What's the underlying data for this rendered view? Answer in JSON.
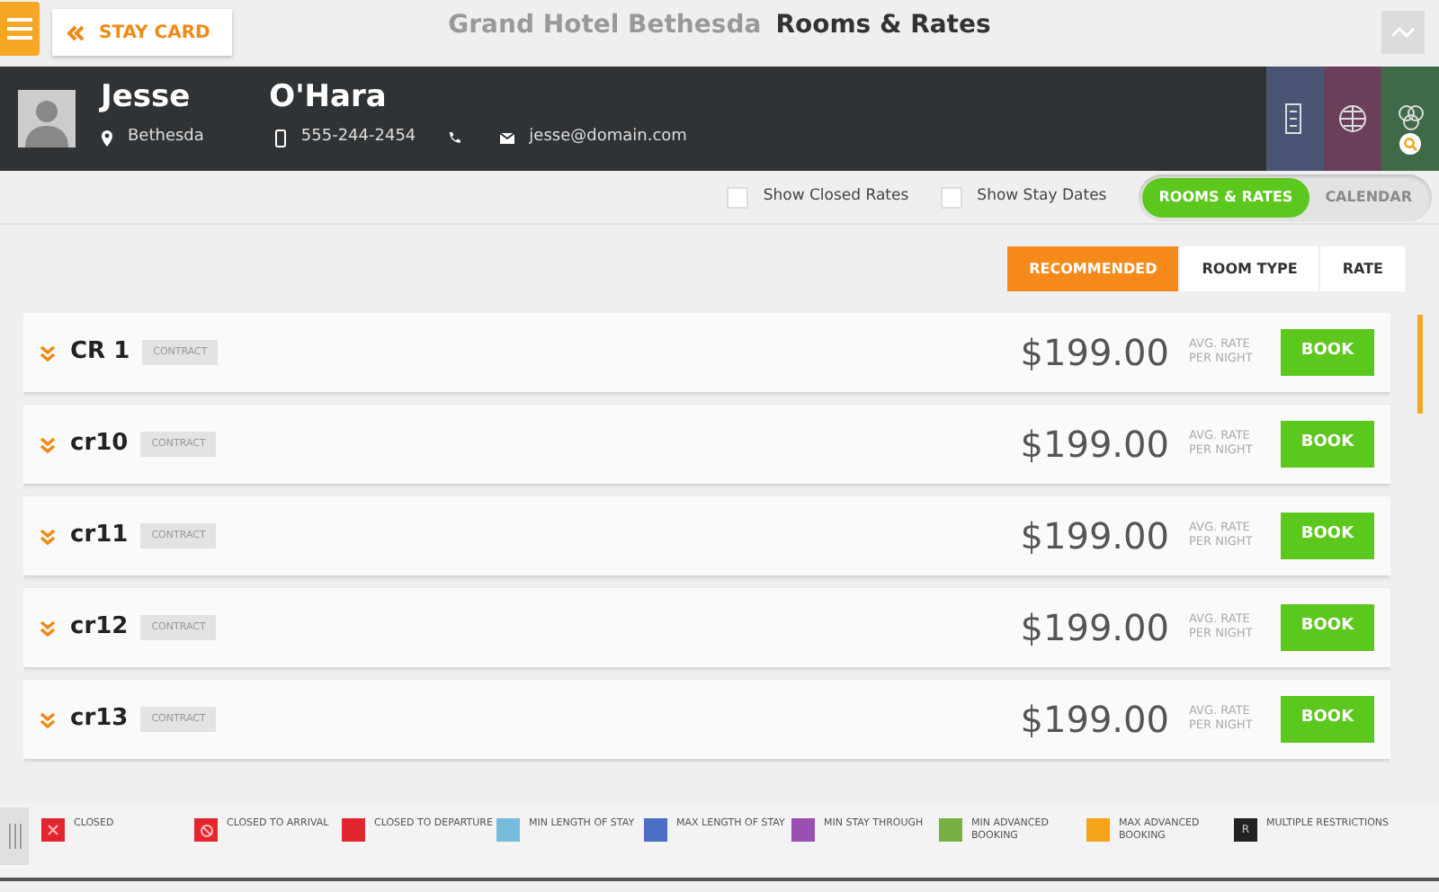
{
  "top_bar": {
    "back_label": "STAY CARD",
    "hotel": "Grand Hotel Bethesda",
    "page_title": "Rooms & Rates"
  },
  "guest": {
    "first_name": "Jesse",
    "last_name": "O'Hara",
    "city": "Bethesda",
    "mobile": "555-244-2454",
    "email": "jesse@domain.com"
  },
  "side_tabs": [
    {
      "kind": "door",
      "color": "#4a5575"
    },
    {
      "kind": "globe",
      "color": "#6b3f5a"
    },
    {
      "kind": "people",
      "color": "#3f6a48"
    }
  ],
  "filters": [
    {
      "label": "Show Closed Rates",
      "checked": false
    },
    {
      "label": "Show Stay Dates",
      "checked": false
    }
  ],
  "view_toggle": [
    {
      "label": "ROOMS & RATES",
      "selected": true
    },
    {
      "label": "CALENDAR",
      "selected": false
    }
  ],
  "sort_tabs": [
    {
      "label": "RECOMMENDED",
      "selected": true
    },
    {
      "label": "ROOM TYPE",
      "selected": false
    },
    {
      "label": "RATE",
      "selected": false
    }
  ],
  "rooms": [
    {
      "name": "CR 1",
      "tag": "CONTRACT",
      "price": "$199.00",
      "rate_note": "AVG. RATE PER NIGHT",
      "action": "BOOK"
    },
    {
      "name": "cr10",
      "tag": "CONTRACT",
      "price": "$199.00",
      "rate_note": "AVG. RATE PER NIGHT",
      "action": "BOOK"
    },
    {
      "name": "cr11",
      "tag": "CONTRACT",
      "price": "$199.00",
      "rate_note": "AVG. RATE PER NIGHT",
      "action": "BOOK"
    },
    {
      "name": "cr12",
      "tag": "CONTRACT",
      "price": "$199.00",
      "rate_note": "AVG. RATE PER NIGHT",
      "action": "BOOK"
    },
    {
      "name": "cr13",
      "tag": "CONTRACT",
      "price": "$199.00",
      "rate_note": "AVG. RATE PER NIGHT",
      "action": "BOOK"
    }
  ],
  "legend": [
    {
      "label": "CLOSED",
      "color": "#e3262e",
      "kind": "cross"
    },
    {
      "label": "CLOSED TO ARRIVAL",
      "color": "#e3262e",
      "kind": "ban"
    },
    {
      "label": "CLOSED TO DEPARTURE",
      "color": "#e3262e",
      "kind": "plain"
    },
    {
      "label": "MIN LENGTH OF STAY",
      "color": "#76bbdc",
      "kind": "plain"
    },
    {
      "label": "MAX LENGTH OF STAY",
      "color": "#4a6fc4",
      "kind": "plain"
    },
    {
      "label": "MIN STAY THROUGH",
      "color": "#9b4fb0",
      "kind": "plain"
    },
    {
      "label": "MIN ADVANCED BOOKING",
      "color": "#79b042",
      "kind": "plain"
    },
    {
      "label": "MAX ADVANCED BOOKING",
      "color": "#f7a21b",
      "kind": "plain"
    },
    {
      "label": "MULTIPLE RESTRICTIONS",
      "color": "#222222",
      "kind": "letter",
      "mark": "R"
    }
  ]
}
